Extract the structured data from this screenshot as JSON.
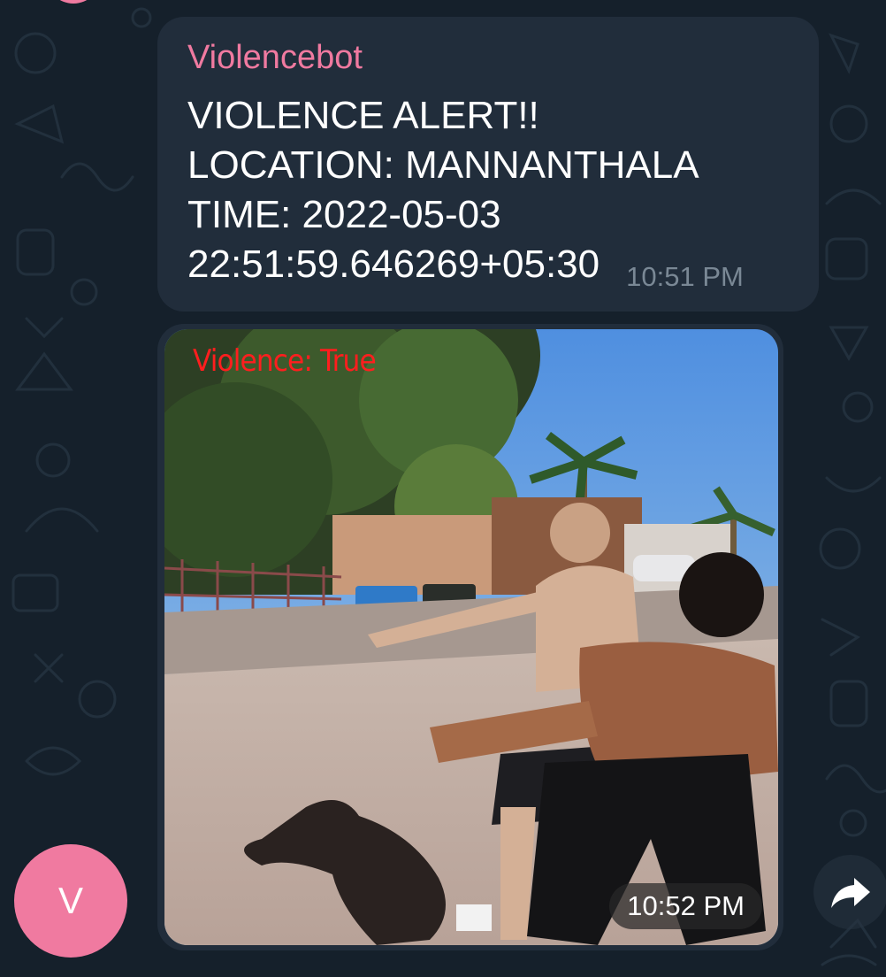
{
  "chat": {
    "top_avatar_color": "#f07aa0",
    "text_message": {
      "sender": "Violencebot",
      "lines": [
        "VIOLENCE ALERT!!",
        "LOCATION: MANNANTHALA",
        "TIME: 2022-05-03",
        "22:51:59.646269+05:30"
      ],
      "time": "10:51 PM"
    },
    "media_message": {
      "overlay_label": "Violence: True",
      "time": "10:52 PM"
    },
    "avatar": {
      "initial": "V",
      "color": "#f07aa0"
    },
    "forward_icon": "forward-arrow-icon"
  },
  "colors": {
    "background": "#15202b",
    "bubble": "#212d3b",
    "sender_name": "#f07aa0",
    "time_text": "#7a8895",
    "overlay_label": "#ff1e1e"
  }
}
